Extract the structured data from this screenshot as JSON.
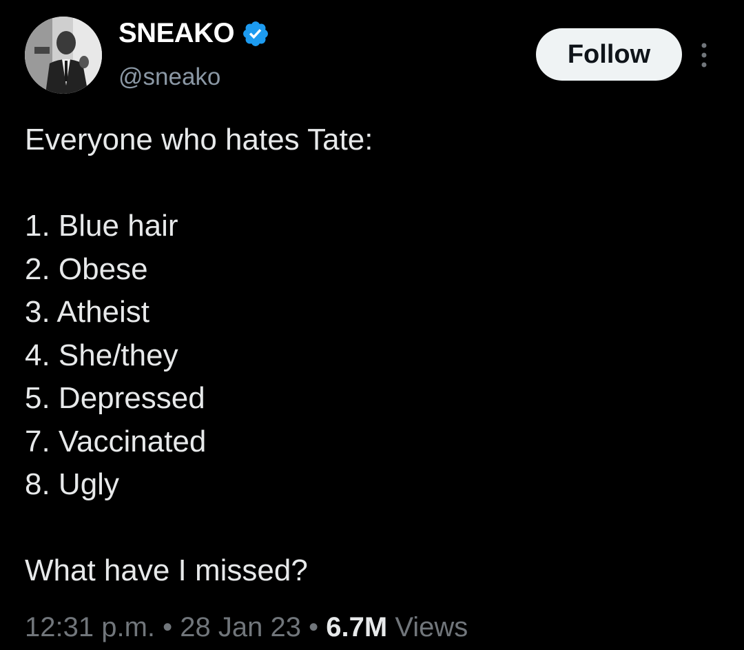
{
  "author": {
    "display_name": "SNEAKO",
    "handle": "@sneako",
    "verified_color": "#1d9bf0"
  },
  "actions": {
    "follow_label": "Follow",
    "more_icon": "more-vertical-icon"
  },
  "tweet": {
    "intro": "Everyone who hates Tate:",
    "items": [
      "1. Blue hair",
      "2. Obese",
      "3. Atheist",
      "4. She/they",
      "5. Depressed",
      "7. Vaccinated",
      "8. Ugly"
    ],
    "closing": "What have I missed?"
  },
  "meta": {
    "time": "12:31 p.m.",
    "separator": "•",
    "date": "28 Jan 23",
    "views_count": "6.7M",
    "views_label": "Views"
  },
  "colors": {
    "background": "#000000",
    "text": "#e7e9ea",
    "secondary": "#71767b",
    "follow_bg": "#eff3f4"
  }
}
